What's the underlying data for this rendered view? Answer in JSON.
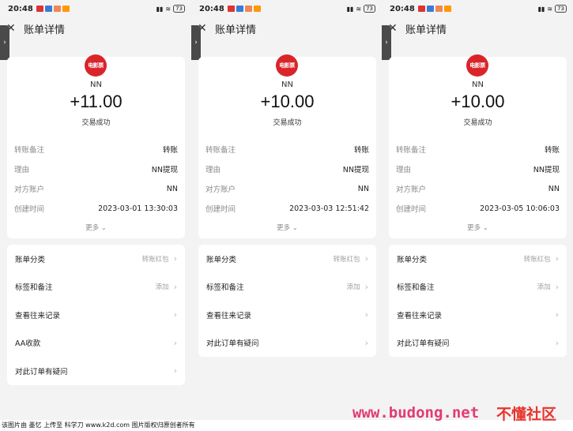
{
  "panels": [
    {
      "status_time": "20:48",
      "battery": "73",
      "header_title": "账单详情",
      "logo_text": "电影票",
      "payer": "NN",
      "amount": "+11.00",
      "status": "交易成功",
      "rows": [
        {
          "key": "转账备注",
          "value": "转账"
        },
        {
          "key": "理由",
          "value": "NN提现"
        },
        {
          "key": "对方账户",
          "value": "NN"
        },
        {
          "key": "创建时间",
          "value": "2023-03-01 13:30:03"
        }
      ],
      "more": "更多",
      "items": [
        {
          "label": "账单分类",
          "right": "转账红包"
        },
        {
          "label": "标签和备注",
          "right": "添加"
        },
        {
          "label": "查看往来记录",
          "right": ""
        },
        {
          "label": "AA收款",
          "right": ""
        },
        {
          "label": "对此订单有疑问",
          "right": ""
        }
      ]
    },
    {
      "status_time": "20:48",
      "battery": "73",
      "header_title": "账单详情",
      "logo_text": "电影票",
      "payer": "NN",
      "amount": "+10.00",
      "status": "交易成功",
      "rows": [
        {
          "key": "转账备注",
          "value": "转账"
        },
        {
          "key": "理由",
          "value": "NN提现"
        },
        {
          "key": "对方账户",
          "value": "NN"
        },
        {
          "key": "创建时间",
          "value": "2023-03-03 12:51:42"
        }
      ],
      "more": "更多",
      "items": [
        {
          "label": "账单分类",
          "right": "转账红包"
        },
        {
          "label": "标签和备注",
          "right": "添加"
        },
        {
          "label": "查看往来记录",
          "right": ""
        },
        {
          "label": "对此订单有疑问",
          "right": ""
        }
      ]
    },
    {
      "status_time": "20:48",
      "battery": "73",
      "header_title": "账单详情",
      "logo_text": "电影票",
      "payer": "NN",
      "amount": "+10.00",
      "status": "交易成功",
      "rows": [
        {
          "key": "转账备注",
          "value": "转账"
        },
        {
          "key": "理由",
          "value": "NN提现"
        },
        {
          "key": "对方账户",
          "value": "NN"
        },
        {
          "key": "创建时间",
          "value": "2023-03-05 10:06:03"
        }
      ],
      "more": "更多",
      "items": [
        {
          "label": "账单分类",
          "right": "转账红包"
        },
        {
          "label": "标签和备注",
          "right": "添加"
        },
        {
          "label": "查看往来记录",
          "right": ""
        },
        {
          "label": "对此订单有疑问",
          "right": ""
        }
      ]
    }
  ],
  "footer_text": "该图片由 墨忆 上传至 科学刀 www.k2d.com 图片版权归原创者所有",
  "watermark_url": "www.budong.net",
  "watermark_brand": "不懂社区",
  "colors": {
    "logo": "#d9252a",
    "watermark": "#e23b74"
  }
}
